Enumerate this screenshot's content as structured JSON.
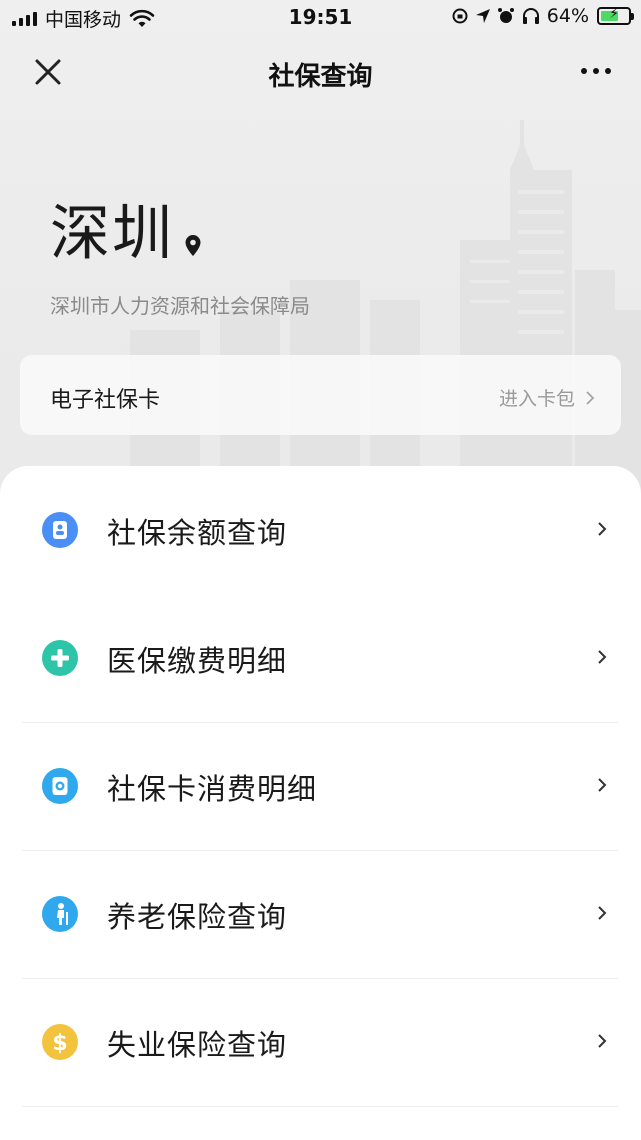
{
  "status_bar": {
    "carrier": "中国移动",
    "time": "19:51",
    "battery_percent_label": "64%",
    "battery_level": 0.64,
    "icons": [
      "signal-icon",
      "wifi-icon",
      "orientation-lock-icon",
      "location-arrow-icon",
      "alarm-icon",
      "headphones-icon",
      "battery-icon"
    ]
  },
  "nav": {
    "title": "社保查询",
    "close_icon": "close-icon",
    "more_icon": "more-icon"
  },
  "hero": {
    "city": "深圳",
    "city_icon": "location-pin-icon",
    "bureau": "深圳市人力资源和社会保障局"
  },
  "card": {
    "title": "电子社保卡",
    "link_label": "进入卡包"
  },
  "services": [
    {
      "label": "社保余额查询",
      "icon": "id-card-icon",
      "color": "#4a8ff5"
    },
    {
      "label": "医保缴费明细",
      "icon": "plus-icon",
      "color": "#2ec4a8"
    },
    {
      "label": "社保卡消费明细",
      "icon": "card-icon",
      "color": "#2fa8ee"
    },
    {
      "label": "养老保险查询",
      "icon": "elderly-icon",
      "color": "#2fa8ee"
    },
    {
      "label": "失业保险查询",
      "icon": "dollar-icon",
      "color": "#f3c33e"
    }
  ],
  "colors": {
    "background": "#ededed",
    "panel": "#ffffff",
    "secondary_text": "#8a8a8a"
  }
}
